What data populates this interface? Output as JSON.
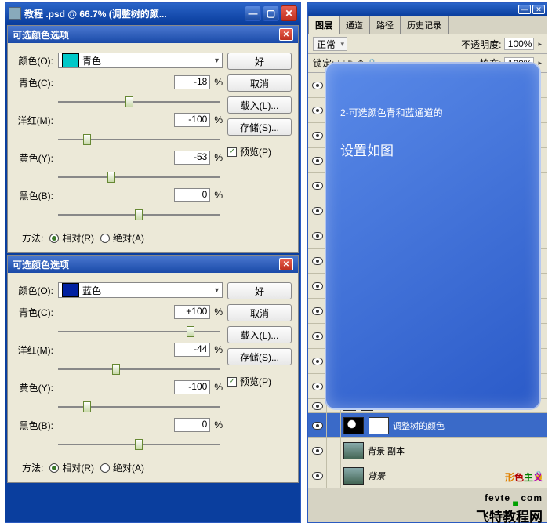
{
  "mainWindow": {
    "title": "教程 .psd @ 66.7% (调整树的颜..."
  },
  "dialog1": {
    "title": "可选颜色选项",
    "colorLabel": "颜色(O):",
    "colorName": "青色",
    "swatch": "#00c8c8",
    "sliders": {
      "cyan": {
        "label": "青色(C):",
        "value": "-18",
        "unit": "%",
        "pos": 44
      },
      "magenta": {
        "label": "洋红(M):",
        "value": "-100",
        "unit": "%",
        "pos": 18
      },
      "yellow": {
        "label": "黄色(Y):",
        "value": "-53",
        "unit": "%",
        "pos": 33
      },
      "black": {
        "label": "黑色(B):",
        "value": "0",
        "unit": "%",
        "pos": 50
      }
    },
    "methodLabel": "方法:",
    "relative": "相对(R)",
    "absolute": "绝对(A)",
    "buttons": {
      "ok": "好",
      "cancel": "取消",
      "load": "载入(L)...",
      "save": "存储(S)..."
    },
    "preview": "预览(P)"
  },
  "dialog2": {
    "title": "可选颜色选项",
    "colorLabel": "颜色(O):",
    "colorName": "蓝色",
    "swatch": "#0020a0",
    "sliders": {
      "cyan": {
        "label": "青色(C):",
        "value": "+100",
        "unit": "%",
        "pos": 82
      },
      "magenta": {
        "label": "洋红(M):",
        "value": "-44",
        "unit": "%",
        "pos": 36
      },
      "yellow": {
        "label": "黄色(Y):",
        "value": "-100",
        "unit": "%",
        "pos": 18
      },
      "black": {
        "label": "黑色(B):",
        "value": "0",
        "unit": "%",
        "pos": 50
      }
    },
    "methodLabel": "方法:",
    "relative": "相对(R)",
    "absolute": "绝对(A)",
    "buttons": {
      "ok": "好",
      "cancel": "取消",
      "load": "载入(L)...",
      "save": "存储(S)..."
    },
    "preview": "预览(P)"
  },
  "layersPanel": {
    "tabs": [
      "图层",
      "通道",
      "路径",
      "历史记录"
    ],
    "blendMode": "正常",
    "opacityLabel": "不透明度:",
    "opacityValue": "100%",
    "lockLabel": "锁定:",
    "fillLabel": "填充:",
    "fillValue": "100%",
    "layers": [
      {
        "name": "",
        "type": "blank"
      },
      {
        "name": "",
        "type": "blank"
      },
      {
        "name": "",
        "type": "blank"
      },
      {
        "name": "",
        "type": "blank"
      },
      {
        "name": "",
        "type": "blank"
      },
      {
        "name": "",
        "type": "blank"
      },
      {
        "name": "",
        "type": "blank"
      },
      {
        "name": "",
        "type": "blank"
      },
      {
        "name": "",
        "type": "blank"
      },
      {
        "name": "",
        "type": "blank"
      },
      {
        "name": "",
        "type": "blank"
      },
      {
        "name": "",
        "type": "blank"
      },
      {
        "name": "",
        "type": "blank"
      },
      {
        "name": "",
        "type": "short"
      },
      {
        "name": "调整树的颜色",
        "type": "adjust",
        "selected": true
      },
      {
        "name": "背景 副本",
        "type": "photo"
      },
      {
        "name": "背景",
        "type": "photo",
        "italic": true,
        "locked": true
      }
    ]
  },
  "note": {
    "line1": "2-可选颜色青和蓝通道的",
    "line2": "设置如图"
  },
  "watermark": {
    "brand": "形色主义",
    "site1": "fevte",
    "site2": "com",
    "tag": "飞特教程网"
  }
}
